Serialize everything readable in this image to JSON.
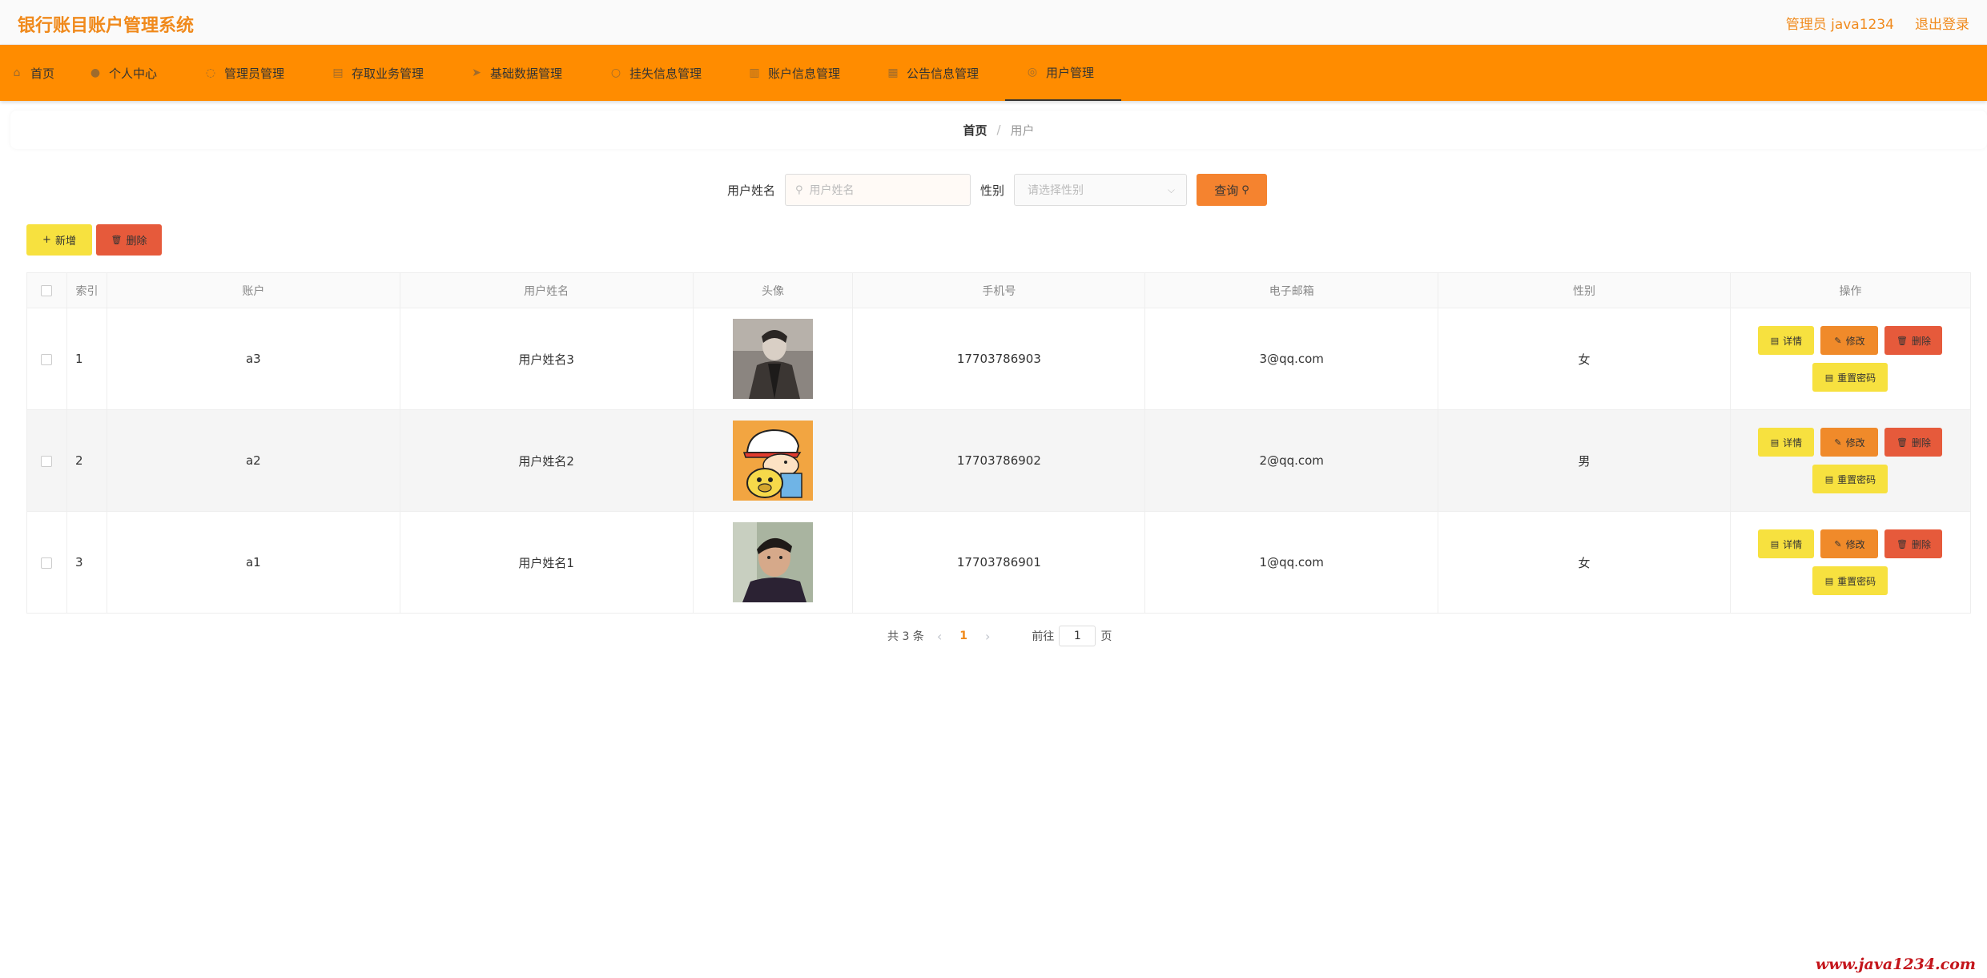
{
  "header": {
    "title": "银行账目账户管理系统",
    "user": "管理员 java1234",
    "logout": "退出登录"
  },
  "nav": {
    "items": [
      {
        "label": "首页",
        "icon": "home-icon"
      },
      {
        "label": "个人中心",
        "icon": "user-icon"
      },
      {
        "label": "管理员管理",
        "icon": "admin-icon"
      },
      {
        "label": "存取业务管理",
        "icon": "business-icon"
      },
      {
        "label": "基础数据管理",
        "icon": "data-icon"
      },
      {
        "label": "挂失信息管理",
        "icon": "report-loss-icon"
      },
      {
        "label": "账户信息管理",
        "icon": "account-icon"
      },
      {
        "label": "公告信息管理",
        "icon": "notice-icon"
      },
      {
        "label": "用户管理",
        "icon": "users-icon",
        "active": true
      }
    ]
  },
  "breadcrumb": {
    "home": "首页",
    "sep": "/",
    "current": "用户"
  },
  "search": {
    "name_label": "用户姓名",
    "name_placeholder": "用户姓名",
    "gender_label": "性别",
    "gender_placeholder": "请选择性别",
    "query_label": "查询"
  },
  "toolbar": {
    "add_label": "新增",
    "delete_label": "删除"
  },
  "table": {
    "columns": [
      "索引",
      "账户",
      "用户姓名",
      "头像",
      "手机号",
      "电子邮箱",
      "性别",
      "操作"
    ],
    "rows": [
      {
        "index": "1",
        "account": "a3",
        "name": "用户姓名3",
        "phone": "17703786903",
        "email": "3@qq.com",
        "gender": "女",
        "avatar": "avatar-photo-coat"
      },
      {
        "index": "2",
        "account": "a2",
        "name": "用户姓名2",
        "phone": "17703786902",
        "email": "2@qq.com",
        "gender": "男",
        "avatar": "avatar-cartoon"
      },
      {
        "index": "3",
        "account": "a1",
        "name": "用户姓名1",
        "phone": "17703786901",
        "email": "1@qq.com",
        "gender": "女",
        "avatar": "avatar-photo-man"
      }
    ],
    "actions": {
      "detail": "详情",
      "edit": "修改",
      "delete": "删除",
      "reset": "重置密码"
    }
  },
  "pagination": {
    "total": "共 3 条",
    "current_page": "1",
    "goto_label": "前往",
    "page_input": "1",
    "page_suffix": "页"
  },
  "watermark": "www.java1234.com",
  "colors": {
    "accent": "#ff8c00",
    "title": "#f08a1c",
    "yellow_button": "#f7e13f",
    "red_button": "#e65a3b",
    "orange_button": "#f08a2a"
  }
}
